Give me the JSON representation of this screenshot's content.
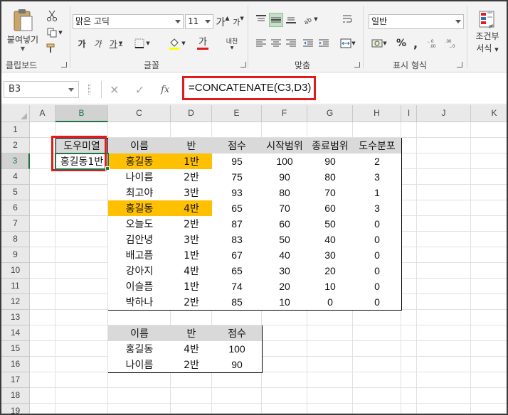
{
  "ribbon": {
    "paste_label": "붙여넣기",
    "clipboard_label": "클립보드",
    "font_name": "맑은 고딕",
    "font_size": "11",
    "bold": "가",
    "italic": "가",
    "underline": "가",
    "font_color_glyph": "가",
    "phonetic_label": "내천",
    "font_group_label": "글꼴",
    "align_group_label": "맞춤",
    "number_format": "일반",
    "number_group_label": "표시 형식",
    "conditional_label_1": "조건부",
    "conditional_label_2": "서식",
    "percent": "%",
    "comma": ",",
    "increase_font": "가",
    "decrease_font": "가"
  },
  "formula_bar": {
    "name_box": "B3",
    "fx": "fx",
    "formula": "=CONCATENATE(C3,D3)"
  },
  "columns": [
    "A",
    "B",
    "C",
    "D",
    "E",
    "F",
    "G",
    "H",
    "I",
    "J",
    "K"
  ],
  "rows": [
    "1",
    "2",
    "3",
    "4",
    "5",
    "6",
    "7",
    "8",
    "9",
    "10",
    "11",
    "12",
    "13",
    "14",
    "15",
    "16",
    "17",
    "18",
    "19"
  ],
  "helper": {
    "header": "도우미열",
    "value": "홍길동1반"
  },
  "main_table": {
    "headers": [
      "이름",
      "반",
      "점수",
      "시작범위",
      "종료범위",
      "도수분포"
    ],
    "rows": [
      [
        "홍길동",
        "1반",
        "95",
        "100",
        "90",
        "2"
      ],
      [
        "나이름",
        "2반",
        "75",
        "90",
        "80",
        "3"
      ],
      [
        "최고야",
        "3반",
        "93",
        "80",
        "70",
        "1"
      ],
      [
        "홍길동",
        "4반",
        "65",
        "70",
        "60",
        "3"
      ],
      [
        "오늘도",
        "2반",
        "87",
        "60",
        "50",
        "0"
      ],
      [
        "김안녕",
        "3반",
        "83",
        "50",
        "40",
        "0"
      ],
      [
        "배고픔",
        "1반",
        "67",
        "40",
        "30",
        "0"
      ],
      [
        "강아지",
        "4반",
        "65",
        "30",
        "20",
        "0"
      ],
      [
        "이슬픔",
        "1반",
        "74",
        "20",
        "10",
        "0"
      ],
      [
        "박하나",
        "2반",
        "85",
        "10",
        "0",
        "0"
      ]
    ]
  },
  "result_table": {
    "headers": [
      "이름",
      "반",
      "점수"
    ],
    "rows": [
      [
        "홍길동",
        "4반",
        "100"
      ],
      [
        "나이름",
        "2반",
        "90"
      ]
    ]
  },
  "colors": {
    "header_fill": "#d9d9d9",
    "highlight_fill": "#ffc000",
    "red_box": "#e01b1b",
    "selection_green": "#217346"
  }
}
